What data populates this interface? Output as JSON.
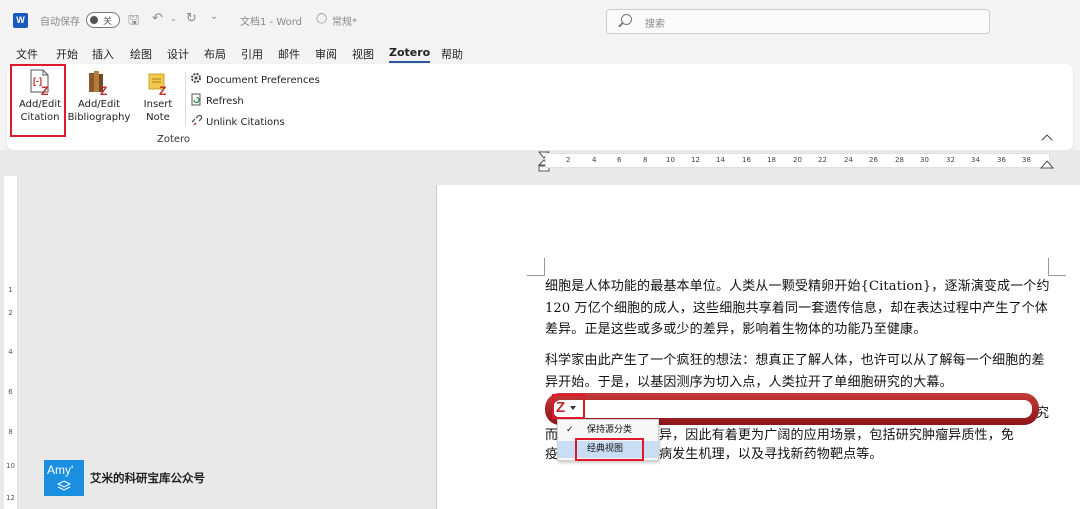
{
  "titlebar": {
    "autosave_label": "自动保存",
    "autosave_state": "关",
    "doc_title": "文档1 - Word",
    "sensitivity": "常规*",
    "search_placeholder": "搜索"
  },
  "menu": {
    "tabs": [
      "文件",
      "开始",
      "插入",
      "绘图",
      "设计",
      "布局",
      "引用",
      "邮件",
      "审阅",
      "视图",
      "Zotero",
      "帮助"
    ],
    "active": "Zotero"
  },
  "ribbon": {
    "add_edit_citation": [
      "Add/Edit",
      "Citation"
    ],
    "add_edit_bibliography": [
      "Add/Edit",
      "Bibliography"
    ],
    "insert_note": [
      "Insert",
      "Note"
    ],
    "document_preferences": "Document Preferences",
    "refresh": "Refresh",
    "unlink_citations": "Unlink Citations",
    "group_label": "Zotero"
  },
  "ruler": {
    "ticks": [
      "2",
      "4",
      "6",
      "8",
      "10",
      "12",
      "14",
      "16",
      "18",
      "20",
      "22",
      "24",
      "26",
      "28",
      "30",
      "32",
      "34",
      "36",
      "38"
    ],
    "vticks": [
      "1",
      "2",
      "4",
      "6",
      "8",
      "10",
      "12"
    ]
  },
  "document": {
    "para1": "细胞是人体功能的最基本单位。人类从一颗受精卵开始{Citation}，逐渐演变成一个约 120 万亿个细胞的成人，这些细胞共享着同一套遗传信息，却在表达过程中产生了个体差异。正是这些或多或少的差异，影响着生物体的功能乃至健康。",
    "para2": "科学家由此产生了一个疯狂的想法：想真正了解人体，也许可以从了解每一个细胞的差异开始。于是，以基因测序为切入点，人类拉开了单细胞研究的大幕。",
    "para3_line1_right": "究",
    "para3_line2_left": "而",
    "para3_line2_rest": "异，因此有着更为广阔的应用场景，包括研究肿瘤异质性，免",
    "para3_line3_left": "疫",
    "para3_line3_rest": "病发生机理，以及寻找新药物靶点等。"
  },
  "zotero_bar": {
    "logo": "Z",
    "menu_items": [
      "保持源分类",
      "经典视图"
    ],
    "checked_item": "保持源分类"
  },
  "watermark": {
    "badge": "Amy'",
    "text": "艾米的科研宝库公众号"
  },
  "colors": {
    "word_blue": "#185abd",
    "zotero_red": "#c0282c",
    "highlight_red": "#e0182b",
    "selection_blue": "#c9def5"
  }
}
